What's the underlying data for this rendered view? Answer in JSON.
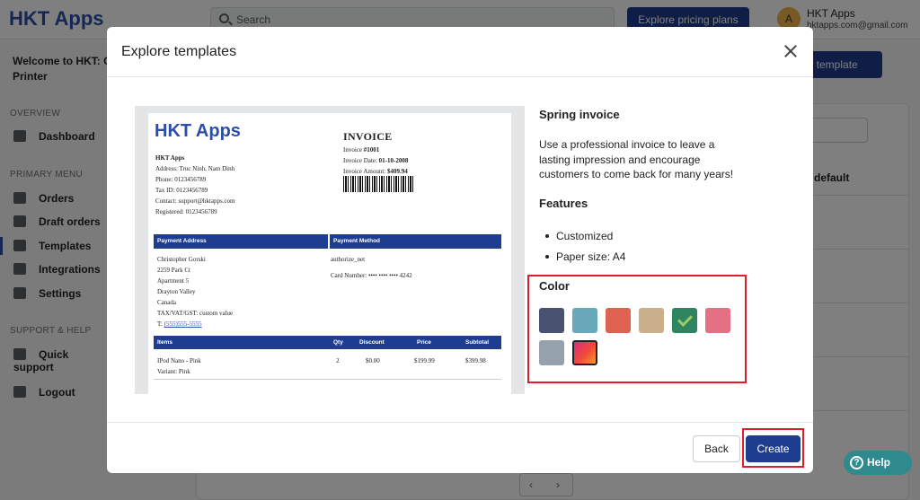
{
  "app": {
    "logo": "HKT Apps",
    "search_placeholder": "Search",
    "pricing_button": "Explore pricing plans",
    "account": {
      "initial": "A",
      "name": "HKT Apps",
      "email": "hktapps.com@gmail.com"
    },
    "welcome": "Welcome to HKT: O",
    "welcome_line2": "Printer",
    "new_template_button": "ew template",
    "default_label": "default"
  },
  "sidebar": {
    "overview_title": "OVERVIEW",
    "primary_title": "PRIMARY MENU",
    "support_title": "SUPPORT & HELP",
    "items": [
      {
        "label": "Dashboard",
        "icon": "home-icon"
      },
      {
        "label": "Orders",
        "icon": "inbox-download-icon"
      },
      {
        "label": "Draft orders",
        "icon": "edit-icon"
      },
      {
        "label": "Templates",
        "icon": "printer-icon"
      },
      {
        "label": "Integrations",
        "icon": "apps-grid-icon"
      },
      {
        "label": "Settings",
        "icon": "gear-icon"
      },
      {
        "label": "Quick support",
        "icon": "chat-icon"
      },
      {
        "label": "Logout",
        "icon": "logout-icon"
      }
    ]
  },
  "pager": {
    "prev": "‹",
    "next": "›"
  },
  "help": {
    "label": "Help",
    "icon": "?"
  },
  "modal": {
    "title": "Explore templates",
    "close_icon": "close-icon",
    "template_name": "Spring invoice",
    "description": "Use a professional invoice to leave a lasting impression and encourage customers to come back for many years!",
    "features_title": "Features",
    "features": [
      "Customized",
      "Paper size: A4"
    ],
    "color_title": "Color",
    "colors": [
      {
        "hex": "#485371",
        "selected": false
      },
      {
        "hex": "#6aa8bb",
        "selected": false
      },
      {
        "hex": "#e06253",
        "selected": false
      },
      {
        "hex": "#c9b08a",
        "selected": false
      },
      {
        "hex": "#2e8560",
        "selected": true
      },
      {
        "hex": "#e57083",
        "selected": false
      },
      {
        "hex": "#95a2ae",
        "selected": false
      },
      {
        "hex": "gradient",
        "selected": false
      }
    ],
    "back_button": "Back",
    "create_button": "Create"
  },
  "invoice": {
    "logo": "HKT Apps",
    "company": "HKT Apps",
    "address": "Address: Truc Ninh, Nam Dinh",
    "phone": "Phone: 0123456789",
    "tax_id": "Tax ID: 0123456789",
    "contact": "Contact: support@hktapps.com",
    "registered": "Registered: 0123456789",
    "title": "INVOICE",
    "number_label": "Invoice ",
    "number": "#1001",
    "date_label": "Invoice Date: ",
    "date": "01-10-2008",
    "amount_label": "Invoice Amount: ",
    "amount": "$409.94",
    "payment_address_head": "Payment Address",
    "payment_method_head": "Payment Method",
    "billing": [
      "Christopher Gorski",
      "2259 Park Ct",
      "Apartment 5",
      "Drayton Valley",
      "Canada",
      "TAX/VAT/GST: custom value"
    ],
    "billing_phone_prefix": "T: ",
    "billing_phone": "(555)555-5555",
    "payment_method": "authorize_net",
    "card_number": "Card Number: •••• •••• •••• 4242",
    "items_head": {
      "items": "Items",
      "qty": "Qty",
      "discount": "Discount",
      "price": "Price",
      "subtotal": "Subtotal"
    },
    "item": {
      "name": "IPod Nano - Pink",
      "variant": "Variant: Pink",
      "qty": "2",
      "discount": "$0.00",
      "price": "$199.99",
      "subtotal": "$399.98"
    }
  }
}
